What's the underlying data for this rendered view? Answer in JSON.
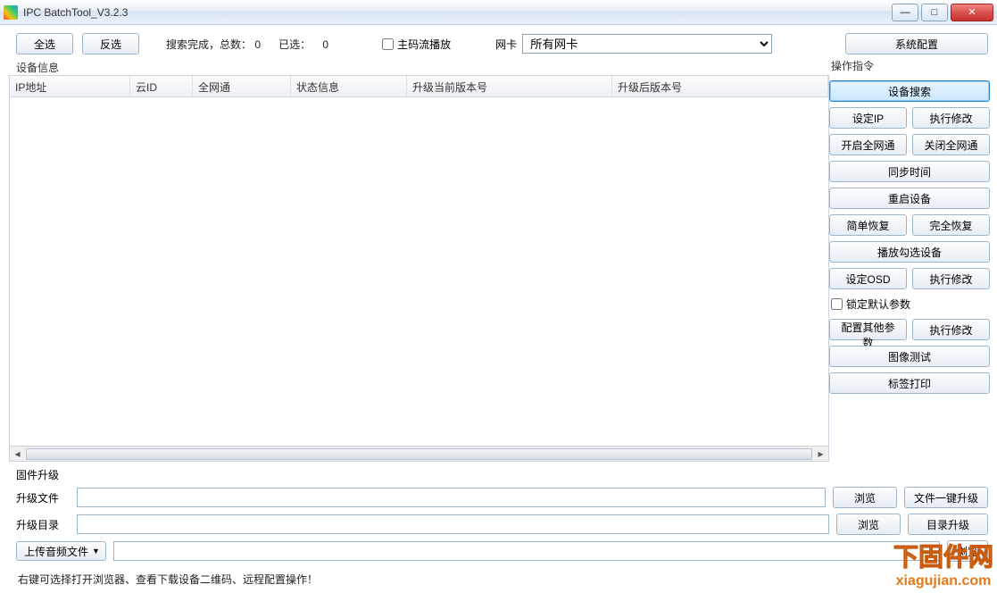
{
  "window": {
    "title": "IPC BatchTool_V3.2.3"
  },
  "topbar": {
    "select_all": "全选",
    "invert": "反选",
    "search_done": "搜索完成，总数：",
    "total": "0",
    "selected_label": "已选：",
    "selected": "0",
    "mainstream_cb": "主码流播放",
    "nic_label": "网卡",
    "nic_value": "所有网卡",
    "syscfg": "系统配置"
  },
  "device_info_label": "设备信息",
  "table": {
    "cols": [
      "IP地址",
      "云ID",
      "全网通",
      "状态信息",
      "升级当前版本号",
      "升级后版本号"
    ]
  },
  "ops_label": "操作指令",
  "ops": {
    "search": "设备搜索",
    "setip": "设定IP",
    "exec1": "执行修改",
    "open_net": "开启全网通",
    "close_net": "关闭全网通",
    "sync_time": "同步时间",
    "reboot": "重启设备",
    "simple_restore": "简单恢复",
    "full_restore": "完全恢复",
    "play_selected": "播放勾选设备",
    "set_osd": "设定OSD",
    "exec2": "执行修改",
    "lock_default": "锁定默认参数",
    "cfg_other": "配置其他参数",
    "exec3": "执行修改",
    "img_test": "图像测试",
    "label_print": "标签打印"
  },
  "fw_label": "固件升级",
  "fw": {
    "file_label": "升级文件",
    "dir_label": "升级目录",
    "browse": "浏览",
    "one_key": "文件一键升级",
    "dir_upgrade": "目录升级",
    "upload_audio": "上传音频文件"
  },
  "footer_tip": "右键可选择打开浏览器、查看下载设备二维码、远程配置操作！",
  "watermark": {
    "cn": "下固件网",
    "url": "xiagujian.com"
  }
}
